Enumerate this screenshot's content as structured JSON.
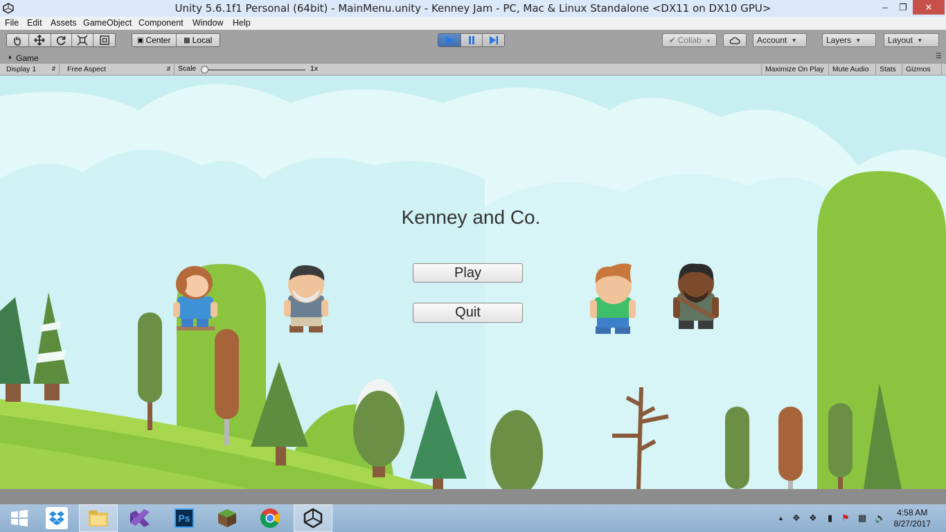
{
  "window": {
    "title": "Unity 5.6.1f1 Personal (64bit) - MainMenu.unity - Kenney Jam - PC, Mac & Linux Standalone <DX11 on DX10 GPU>",
    "controls": {
      "minimize": "–",
      "restore": "❐",
      "close": "✕"
    }
  },
  "menubar": {
    "items": [
      "File",
      "Edit",
      "Assets",
      "GameObject",
      "Component",
      "Window",
      "Help"
    ]
  },
  "toolbar": {
    "pivot_label": "Center",
    "space_label": "Local",
    "collab_label": "Collab",
    "account_label": "Account",
    "layers_label": "Layers",
    "layout_label": "Layout",
    "play_state": "playing"
  },
  "game_tab": {
    "label": "Game"
  },
  "game_toolbar": {
    "display": "Display 1",
    "aspect": "Free Aspect",
    "scale_label": "Scale",
    "scale_value": "1x",
    "maximize_on_play": "Maximize On Play",
    "mute_audio": "Mute Audio",
    "stats": "Stats",
    "gizmos": "Gizmos"
  },
  "game": {
    "title": "Kenney and Co.",
    "play_button": "Play",
    "quit_button": "Quit"
  },
  "taskbar": {
    "apps": [
      "start-icon",
      "dropbox-icon",
      "file-explorer-icon",
      "visual-studio-icon",
      "photoshop-icon",
      "minecraft-icon",
      "chrome-icon",
      "unity-icon"
    ],
    "photoshop_label": "Ps",
    "clock_time": "4:58 AM",
    "clock_date": "8/27/2017"
  },
  "colors": {
    "sky": "#dff6f8",
    "hill": "#8bc53f",
    "tree_dark": "#6a8f45",
    "play_active": "#3f6fae"
  }
}
